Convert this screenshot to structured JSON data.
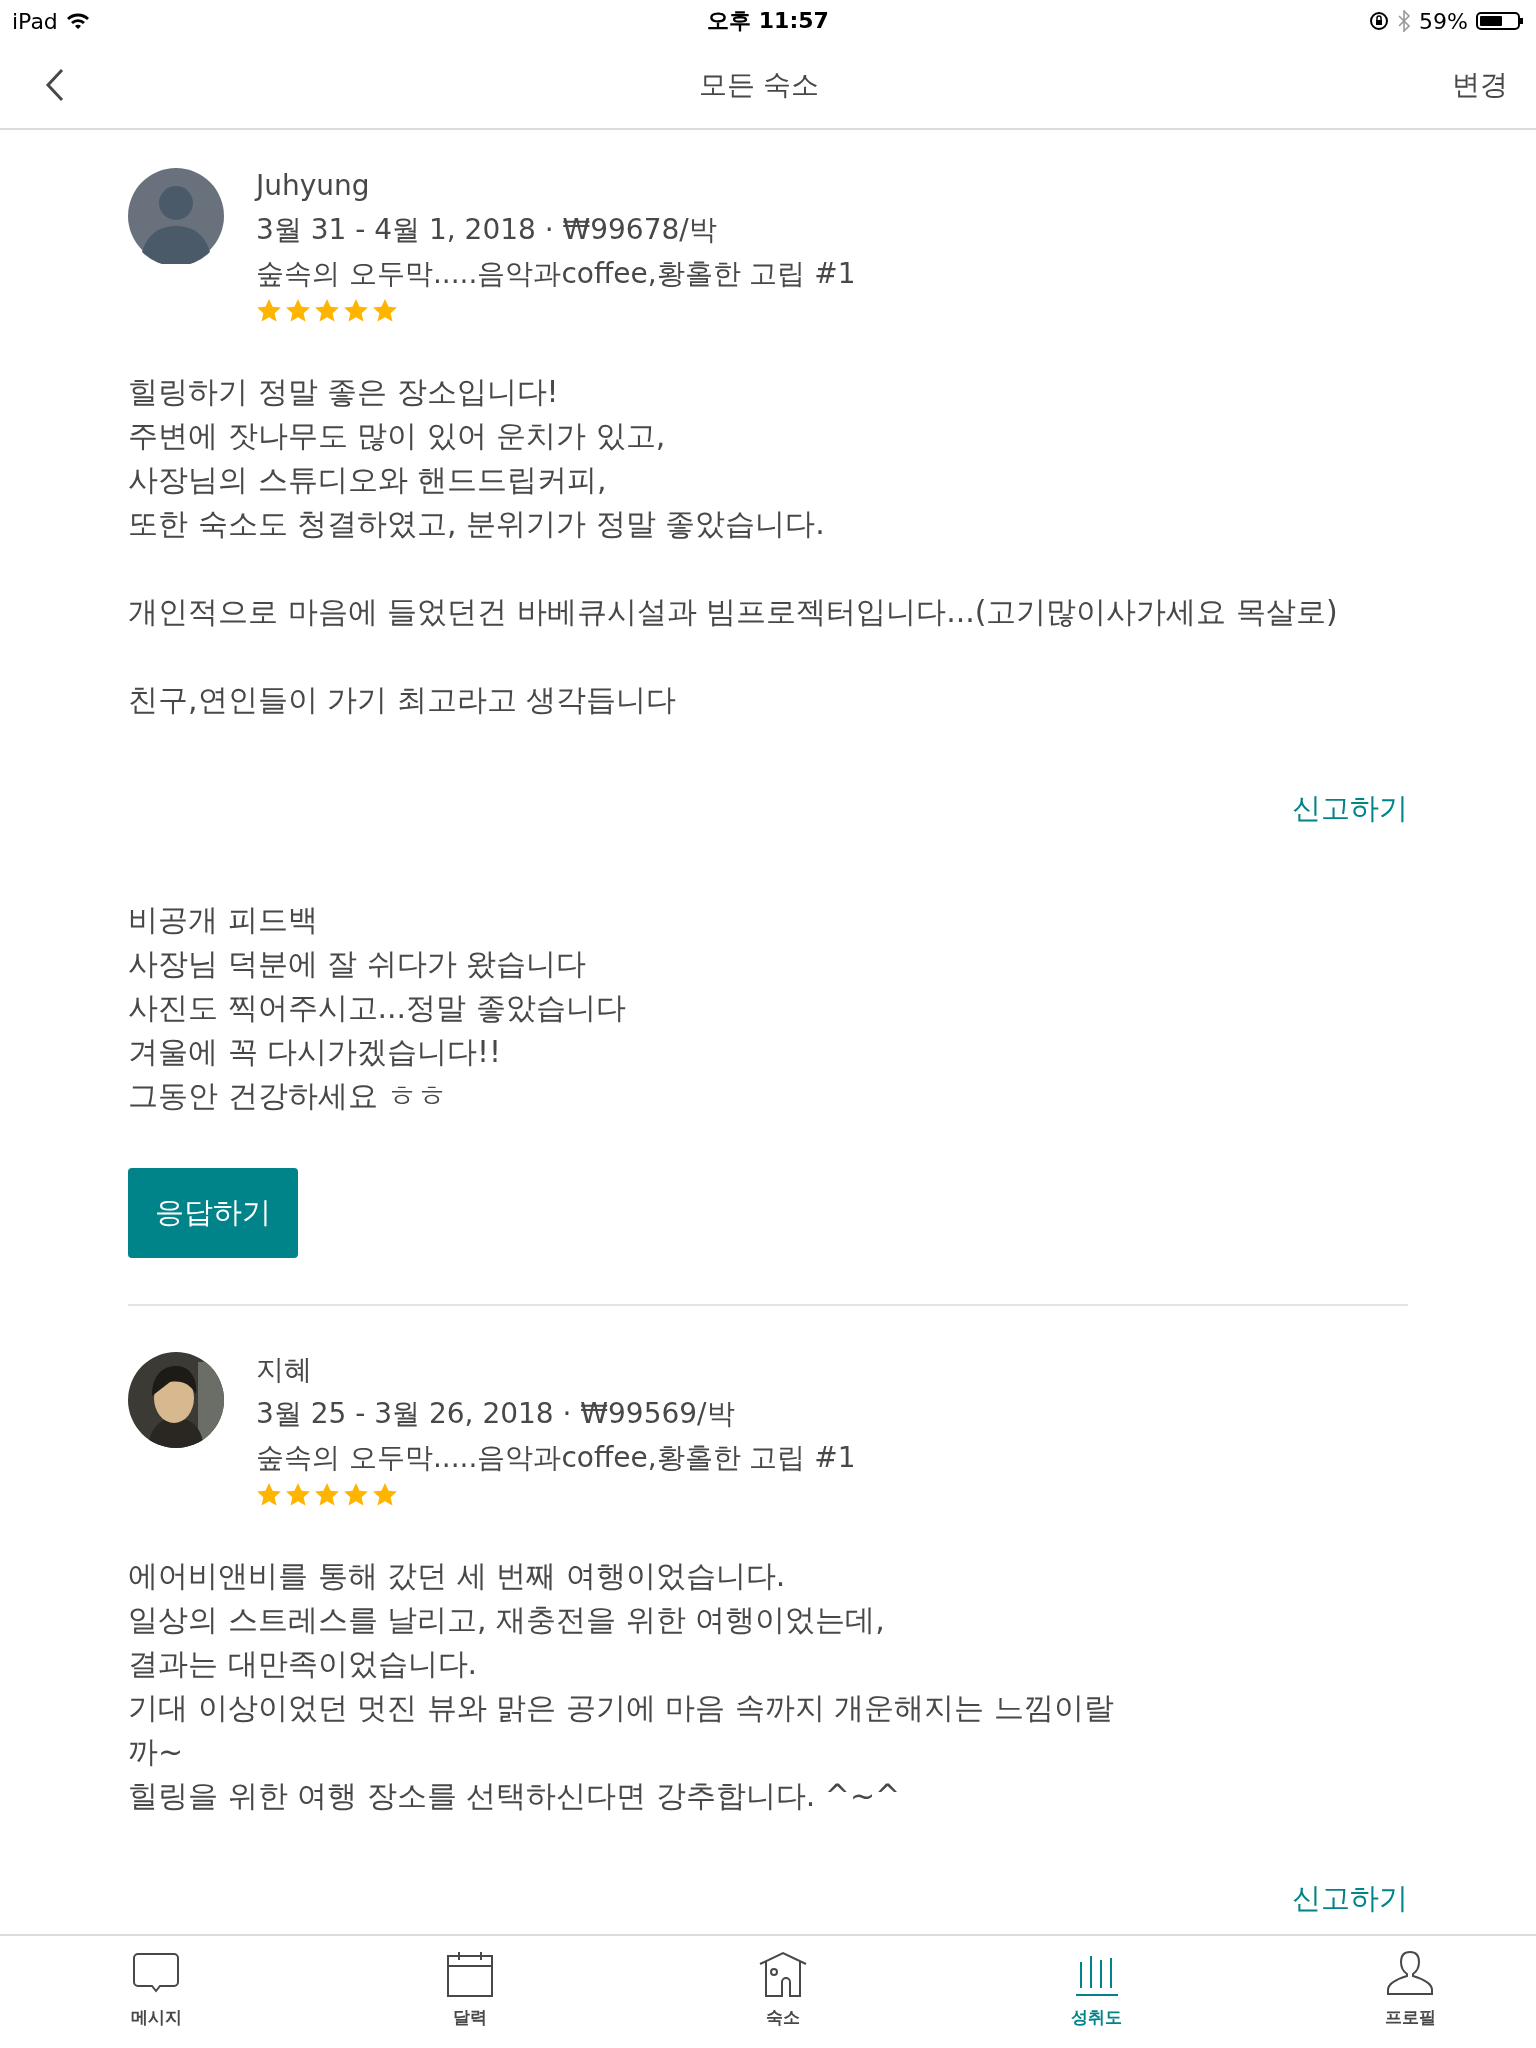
{
  "status_bar": {
    "device": "iPad",
    "time": "오후 11:57",
    "battery": "59%"
  },
  "nav": {
    "title": "모든 숙소",
    "action": "변경"
  },
  "reviews": [
    {
      "avatar": {
        "kind": "default"
      },
      "name": "Juhyung",
      "stay": "3월 31 - 4월 1, 2018 · ₩99678/박",
      "listing": "숲속의 오두막.....음악과coffee,황홀한 고립 #1",
      "stars": 5,
      "body": [
        "힐링하기 정말 좋은 장소입니다!\n주변에 잣나무도 많이 있어 운치가 있고,\n사장님의 스튜디오와 핸드드립커피,\n또한 숙소도 청결하였고, 분위기가 정말 좋았습니다.",
        "개인적으로 마음에 들었던건 바베큐시설과 빔프로젝터입니다...(고기많이사가세요 목살로)",
        "친구,연인들이 가기 최고라고 생각듭니다"
      ],
      "report": "신고하기",
      "private_feedback": {
        "title": "비공개 피드백",
        "text": "사장님 덕분에 잘 쉬다가 왔습니다\n사진도 찍어주시고...정말 좋았습니다\n겨울에 꼭 다시가겠습니다!!\n그동안 건강하세요 ㅎㅎ"
      },
      "reply_button": "응답하기"
    },
    {
      "avatar": {
        "kind": "photo"
      },
      "name": "지혜",
      "stay": "3월 25 - 3월 26, 2018 · ₩99569/박",
      "listing": "숲속의 오두막.....음악과coffee,황홀한 고립 #1",
      "stars": 5,
      "body": [
        "에어비앤비를 통해 갔던 세 번째 여행이었습니다.\n일상의 스트레스를 날리고, 재충전을 위한 여행이었는데,\n결과는 대만족이었습니다.\n기대 이상이었던 멋진 뷰와 맑은 공기에 마음 속까지 개운해지는 느낌이랄\n까~\n힐링을 위한 여행 장소를 선택하신다면 강추합니다. ^~^"
      ],
      "report": "신고하기"
    }
  ],
  "tab_bar": [
    {
      "kind": "chat",
      "label": "메시지",
      "selected": false
    },
    {
      "kind": "calendar",
      "label": "달력",
      "selected": false
    },
    {
      "kind": "house",
      "label": "숙소",
      "selected": false
    },
    {
      "kind": "chart",
      "label": "성취도",
      "selected": true
    },
    {
      "kind": "person",
      "label": "프로필",
      "selected": false
    }
  ]
}
